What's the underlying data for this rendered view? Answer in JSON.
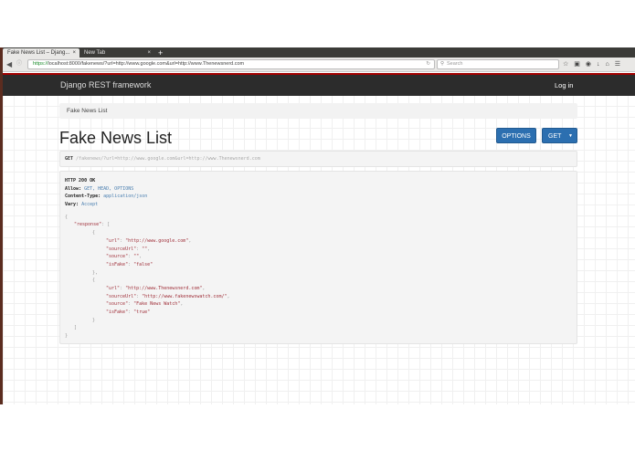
{
  "browser": {
    "tabs": [
      {
        "title": "Fake News List – Djang...",
        "active": true
      },
      {
        "title": "New Tab",
        "active": false
      }
    ],
    "new_tab_glyph": "+",
    "close_glyph": "×",
    "url_protocol": "https://",
    "url_rest": "localhost:8000/fakenews/?url=http://www.google.com&url=http://www.Thenewsnerd.com",
    "search_placeholder": "Search"
  },
  "navbar": {
    "brand": "Django REST framework",
    "login": "Log in"
  },
  "breadcrumb": "Fake News List",
  "page_title": "Fake News List",
  "buttons": {
    "options": "OPTIONS",
    "get": "GET"
  },
  "request": {
    "method": "GET",
    "path": "/fakenews/?url=http://www.google.com&url=http://www.Thenewsnerd.com"
  },
  "response": {
    "status": "HTTP 200 OK",
    "headers": [
      {
        "key": "Allow:",
        "value": "GET, HEAD, OPTIONS"
      },
      {
        "key": "Content-Type:",
        "value": "application/json"
      },
      {
        "key": "Vary:",
        "value": "Accept"
      }
    ],
    "body_lines": [
      {
        "indent": 0,
        "tokens": [
          [
            "punct",
            "{"
          ]
        ]
      },
      {
        "indent": 1,
        "tokens": [
          [
            "key",
            "\"response\""
          ],
          [
            "punct",
            ": ["
          ]
        ]
      },
      {
        "indent": 2,
        "tokens": [
          [
            "punct",
            "{"
          ]
        ]
      },
      {
        "indent": 3,
        "tokens": [
          [
            "key",
            "\"url\""
          ],
          [
            "punct",
            ": "
          ],
          [
            "str",
            "\"http://www.google.com\""
          ],
          [
            "punct",
            ","
          ]
        ]
      },
      {
        "indent": 3,
        "tokens": [
          [
            "key",
            "\"sourceUrl\""
          ],
          [
            "punct",
            ": "
          ],
          [
            "str",
            "\"\""
          ],
          [
            "punct",
            ","
          ]
        ]
      },
      {
        "indent": 3,
        "tokens": [
          [
            "key",
            "\"source\""
          ],
          [
            "punct",
            ": "
          ],
          [
            "str",
            "\"\""
          ],
          [
            "punct",
            ","
          ]
        ]
      },
      {
        "indent": 3,
        "tokens": [
          [
            "key",
            "\"isFake\""
          ],
          [
            "punct",
            ": "
          ],
          [
            "str",
            "\"false\""
          ]
        ]
      },
      {
        "indent": 2,
        "tokens": [
          [
            "punct",
            "},"
          ]
        ]
      },
      {
        "indent": 2,
        "tokens": [
          [
            "punct",
            "{"
          ]
        ]
      },
      {
        "indent": 3,
        "tokens": [
          [
            "key",
            "\"url\""
          ],
          [
            "punct",
            ": "
          ],
          [
            "str",
            "\"http://www.Thenewsnerd.com\""
          ],
          [
            "punct",
            ","
          ]
        ]
      },
      {
        "indent": 3,
        "tokens": [
          [
            "key",
            "\"sourceUrl\""
          ],
          [
            "punct",
            ": "
          ],
          [
            "str",
            "\"http://www.fakenewswatch.com/\""
          ],
          [
            "punct",
            ","
          ]
        ]
      },
      {
        "indent": 3,
        "tokens": [
          [
            "key",
            "\"source\""
          ],
          [
            "punct",
            ": "
          ],
          [
            "str",
            "\"Fake News Watch\""
          ],
          [
            "punct",
            ","
          ]
        ]
      },
      {
        "indent": 3,
        "tokens": [
          [
            "key",
            "\"isFake\""
          ],
          [
            "punct",
            ": "
          ],
          [
            "str",
            "\"true\""
          ]
        ]
      },
      {
        "indent": 2,
        "tokens": [
          [
            "punct",
            "}"
          ]
        ]
      },
      {
        "indent": 1,
        "tokens": [
          [
            "punct",
            "]"
          ]
        ]
      },
      {
        "indent": 0,
        "tokens": [
          [
            "punct",
            "}"
          ]
        ]
      }
    ]
  }
}
